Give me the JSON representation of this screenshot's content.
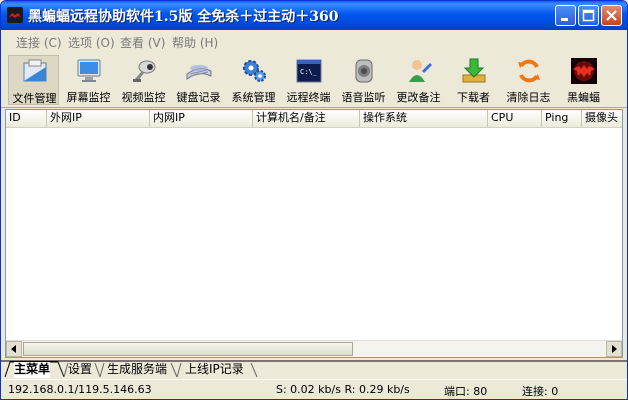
{
  "window": {
    "title": "黑蝙蝠远程协助软件1.5版  全免杀＋过主动＋360"
  },
  "menu": [
    {
      "label": "连接 (C)"
    },
    {
      "label": "选项 (O)"
    },
    {
      "label": "查看 (V)"
    },
    {
      "label": "帮助 (H)"
    }
  ],
  "toolbar": [
    {
      "label": "文件管理",
      "icon": "file-manager-icon"
    },
    {
      "label": "屏幕监控",
      "icon": "monitor-icon"
    },
    {
      "label": "视频监控",
      "icon": "webcam-icon"
    },
    {
      "label": "键盘记录",
      "icon": "keyboard-icon"
    },
    {
      "label": "系统管理",
      "icon": "gears-icon"
    },
    {
      "label": "远程终端",
      "icon": "terminal-icon"
    },
    {
      "label": "语音监听",
      "icon": "speaker-icon"
    },
    {
      "label": "更改备注",
      "icon": "user-edit-icon"
    },
    {
      "label": "下载者",
      "icon": "download-icon"
    },
    {
      "label": "清除日志",
      "icon": "refresh-icon"
    },
    {
      "label": "黑蝙蝠",
      "icon": "bat-icon"
    }
  ],
  "list": {
    "columns": [
      "ID",
      "外网IP",
      "内网IP",
      "计算机名/备注",
      "操作系统",
      "CPU",
      "Ping",
      "摄像头"
    ]
  },
  "tabs": [
    "主菜单",
    "设置",
    "生成服务端",
    "上线IP记录"
  ],
  "status": {
    "ip": "192.168.0.1/119.5.146.63",
    "speed": "S: 0.02 kb/s R: 0.29 kb/s",
    "port": "端口: 80",
    "connections": "连接: 0"
  }
}
